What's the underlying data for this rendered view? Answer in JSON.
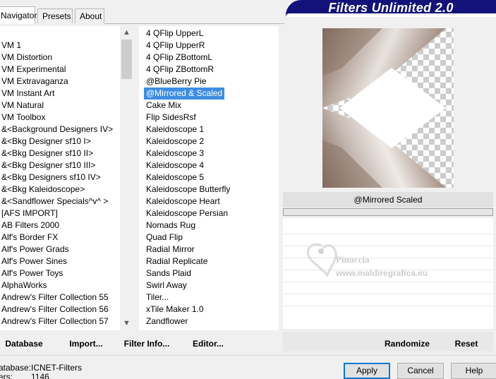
{
  "banner": {
    "title": "Filters Unlimited 2.0"
  },
  "tabs": [
    {
      "label": "Navigator",
      "active": true
    },
    {
      "label": "Presets",
      "active": false
    },
    {
      "label": "About",
      "active": false
    }
  ],
  "categories": [
    "VM 1",
    "VM Distortion",
    "VM Experimental",
    "VM Extravaganza",
    "VM Instant Art",
    "VM Natural",
    "VM Toolbox",
    "&<Background Designers IV>",
    "&<Bkg Designer sf10 I>",
    "&<Bkg Designer sf10 II>",
    "&<Bkg Designer sf10 III>",
    "&<Bkg Designers sf10 IV>",
    "&<Bkg Kaleidoscope>",
    "&<Sandflower Specials^v^ >",
    "[AFS IMPORT]",
    "AB Filters 2000",
    "Alf's Border FX",
    "Alf's Power Grads",
    "Alf's Power Sines",
    "Alf's Power Toys",
    "AlphaWorks",
    "Andrew's Filter Collection 55",
    "Andrew's Filter Collection 56",
    "Andrew's Filter Collection 57"
  ],
  "filters": [
    "4 QFlip UpperL",
    "4 QFlip UpperR",
    "4 QFlip ZBottomL",
    "4 QFlip ZBottomR",
    "@BlueBerry Pie",
    "@Mirrored & Scaled",
    "Cake Mix",
    "Flip SidesRsf",
    "Kaleidoscope 1",
    "Kaleidoscope 2",
    "Kaleidoscope 3",
    "Kaleidoscope 4",
    "Kaleidoscope 5",
    "Kaleidoscope Butterfly",
    "Kaleidoscope Heart",
    "Kaleidoscope Persian",
    "Nomads Rug",
    "Quad Flip",
    "Radial Mirror",
    "Radial Replicate",
    "Sands Plaid",
    "Swirl Away",
    "Tiler...",
    "xTile Maker 1.0",
    "Zandflower"
  ],
  "selected_filter_index": 5,
  "selected_filter_name": "@Mirrored  Scaled",
  "progress_fraction": 0.0,
  "list_buttons": {
    "database": "Database",
    "import": "Import...",
    "filter_info": "Filter Info...",
    "editor": "Editor..."
  },
  "param_buttons": {
    "randomize": "Randomize",
    "reset": "Reset"
  },
  "dialog_buttons": {
    "apply": "Apply",
    "cancel": "Cancel",
    "help": "Help"
  },
  "status": {
    "database_label": "atabase:",
    "database_value": "ICNET-Filters",
    "filters_label": "ers:",
    "filters_value": "1146"
  },
  "watermark": {
    "line1": "Pinuccia",
    "line2": "www.maldiregrafica.eu"
  },
  "colors": {
    "selection": "#3d8ee3",
    "banner": "#12127a",
    "preview_brown": "#8c7567"
  },
  "icons": {
    "scroll_up": "chevron-up-icon",
    "scroll_down": "chevron-down-icon"
  }
}
